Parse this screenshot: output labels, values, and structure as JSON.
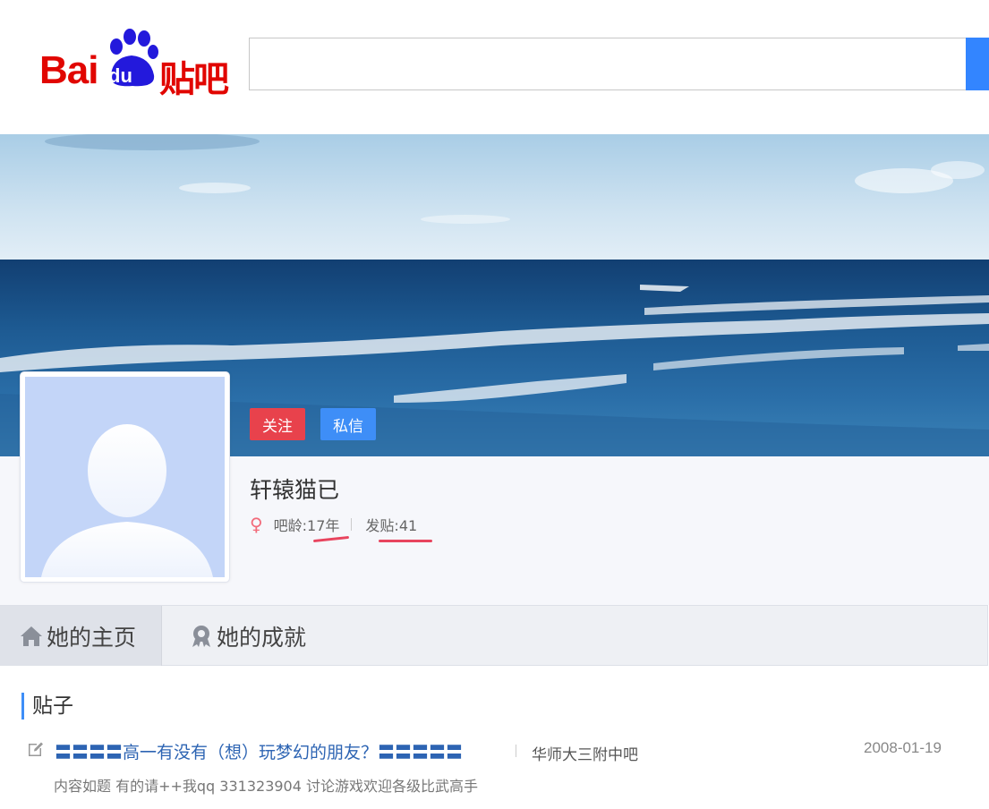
{
  "header": {
    "logo_bai": "Bai",
    "logo_du": "du",
    "logo_tieba": "贴吧",
    "search_value": ""
  },
  "profile": {
    "follow_label": "关注",
    "message_label": "私信",
    "username": "轩辕猫已",
    "gender_icon": "female-icon",
    "age_text": "吧龄:17年",
    "posts_text": "发贴:41"
  },
  "tabs": [
    {
      "label": "她的主页",
      "icon": "home-icon",
      "active": true
    },
    {
      "label": "她的成就",
      "icon": "badge-icon",
      "active": false
    }
  ],
  "posts": {
    "section_title": "贴子",
    "items": [
      {
        "title": "〓〓〓〓高一有没有（想）玩梦幻的朋友？〓〓〓〓〓",
        "forum": "华师大三附中吧",
        "date": "2008-01-19",
        "excerpt": "内容如题 有的请++我qq 331323904 讨论游戏欢迎各级比武高手"
      }
    ]
  },
  "colors": {
    "brand_red": "#e10601",
    "brand_blue": "#2319dc",
    "follow_button": "#e8424c",
    "message_button": "#3e8ef7",
    "link_blue": "#2d64b3",
    "annotation_red": "#e8445e"
  }
}
